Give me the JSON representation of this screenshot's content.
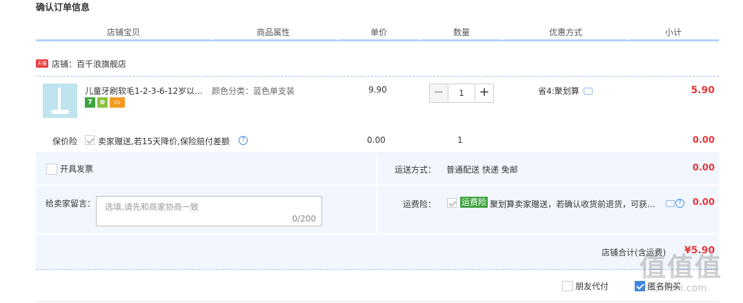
{
  "page": {
    "title": "确认订单信息"
  },
  "columns": [
    "店铺宝贝",
    "商品属性",
    "单价",
    "数量",
    "优惠方式",
    "小计"
  ],
  "shop": {
    "badge": "天猫",
    "label": "店铺：百千浪旗舰店"
  },
  "item": {
    "title": "儿童牙刷软毛1-2-3-6-12岁以...",
    "badges": [
      "7",
      "⊕",
      "▭"
    ],
    "attribute": "颜色分类：蓝色单支装",
    "unit_price": "9.90",
    "quantity": "1",
    "minus": "−",
    "plus": "+",
    "promo": "省4:聚划算",
    "subtotal": "5.90"
  },
  "insurance": {
    "label": "保价险",
    "text": "卖家赠送,若15天降价,保险赔付差额",
    "help": "?",
    "price": "0.00",
    "quantity": "1",
    "subtotal": "0.00"
  },
  "invoice": {
    "label": "开具发票"
  },
  "shipping": {
    "label": "运送方式：",
    "value": "普通配送 快递 免邮",
    "subtotal": "0.00"
  },
  "message": {
    "label": "给卖家留言：",
    "placeholder": "选填,请先和商家协商一致",
    "count": "0/200"
  },
  "freight_insurance": {
    "label": "运费险：",
    "tag": "运费险",
    "text": "聚划算卖家赠送，若确认收货前退货，可获...",
    "help": "?",
    "subtotal": "0.00"
  },
  "shop_total": {
    "label": "店铺合计(含运费)",
    "value": "¥5.90"
  },
  "bottom": {
    "friend_pay": "朋友代付",
    "anonymous": "匿名购买"
  },
  "watermark": {
    "main": "值值值",
    "sub": "zhizhizhi.com"
  },
  "colors": {
    "accent": "#3f86e0",
    "price_red": "#e4393c",
    "tag_green": "#3ea33e",
    "grey_bg": "#f2f7ff"
  }
}
